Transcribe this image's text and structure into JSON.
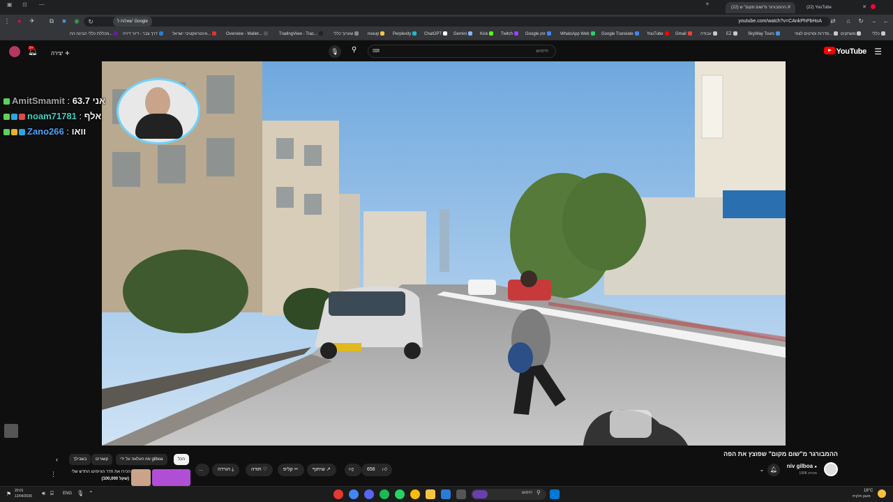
{
  "browser": {
    "tabs": [
      {
        "title": "(22) YouTube",
        "active": false
      },
      {
        "title": "(22) ההמבורגר מ\"שום מקום\" ש...",
        "active": true
      }
    ],
    "url": "youtube.com/watch?v=CAnkPhPbHoA",
    "translate_label": "שאלות ל' Google"
  },
  "bookmarks": [
    "כללי",
    "משחקים",
    "סדרות וסרטים לצפי...",
    "SkyWay Tours",
    "EZ",
    "עבודה",
    "Gmail",
    "YouTube",
    "Google Translate",
    "WhatsApp Web",
    "Google זמן",
    "Twitch",
    "Kick",
    "Gemini",
    "ChatGPT",
    "Perplexity",
    "nseup",
    "שערוך כללי",
    "TradingView - Trac...",
    "Overview - Wallet...",
    "אינטראקטיבי ישראל...",
    "דרך צבר - דיור דירה",
    "מכללת כללי הבינה הח..."
  ],
  "youtube": {
    "logo_text": "YouTube",
    "create_label": "יצירה",
    "search_placeholder": "חיפוש",
    "notif_count": "9+"
  },
  "chat": [
    {
      "user": "AmitSmamit",
      "message": "אני 63.7",
      "color": "#a3a3a3"
    },
    {
      "user": "noam71781",
      "message": "אלף",
      "color": "#3ad1c1"
    },
    {
      "user": "Zano266",
      "message": "וואו",
      "color": "#4aa3ff"
    }
  ],
  "video": {
    "title": "ההמבורגר מ\"שום מקום\" שפוצץ את הפה",
    "channel": "niv gilboa",
    "subscribers": "190K מנויים",
    "likes": "656"
  },
  "actions": {
    "share": "שיתוף",
    "clip": "קליפ",
    "thanks": "תודה",
    "download": "הורדה",
    "more": "..."
  },
  "chips": {
    "all": "הכל",
    "from_channel": "העלאה על ידי niv gilboa",
    "related": "קשורים",
    "recent": "בשבילך"
  },
  "related_video": {
    "title": "הכירו את חדר הגיימינג החדש שלי",
    "subtitle": "(100,000 שקל)"
  },
  "taskbar": {
    "search_placeholder": "חיפוש",
    "lang": "ENG",
    "time": "20:01",
    "date": "12/04/2026",
    "weather": "18°C",
    "weather_desc": "מעונן חלקית"
  }
}
